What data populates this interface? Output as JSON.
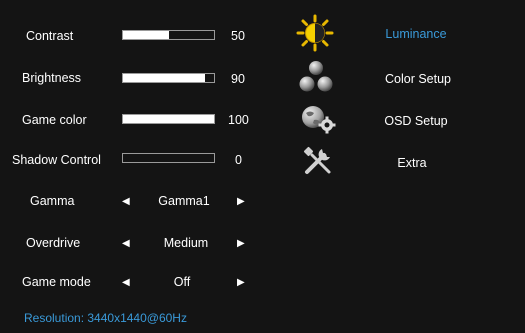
{
  "settings": {
    "sliders": [
      {
        "label": "Contrast",
        "value": "50",
        "level": 0.5
      },
      {
        "label": "Brightness",
        "value": "90",
        "level": 0.9
      },
      {
        "label": "Game color",
        "value": "100",
        "level": 1.0
      },
      {
        "label": "Shadow Control",
        "value": "0",
        "level": 0
      }
    ],
    "selectors": [
      {
        "label": "Gamma",
        "value": "Gamma1"
      },
      {
        "label": "Overdrive",
        "value": "Medium"
      },
      {
        "label": "Game mode",
        "value": "Off"
      }
    ],
    "arrow_left": "◀",
    "arrow_right": "▶"
  },
  "categories": [
    {
      "label": "Luminance",
      "icon": "sun-half-icon",
      "active": true
    },
    {
      "label": "Color Setup",
      "icon": "color-balls-icon",
      "active": false
    },
    {
      "label": "OSD Setup",
      "icon": "globe-gear-icon",
      "active": false
    },
    {
      "label": "Extra",
      "icon": "wrench-screwdriver-icon",
      "active": false
    }
  ],
  "status": {
    "resolution": "Resolution: 3440x1440@60Hz"
  },
  "colors": {
    "background": "#141414",
    "accent": "#3a9ad9",
    "text": "#ffffff"
  }
}
